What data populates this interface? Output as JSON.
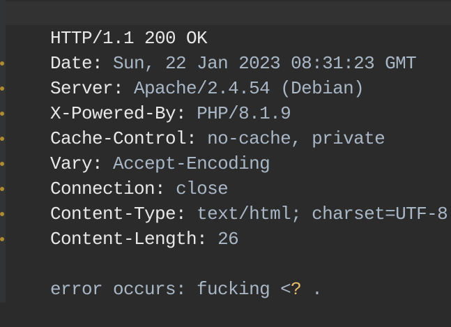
{
  "response": {
    "status_line": "HTTP/1.1 200 OK",
    "headers": [
      {
        "key": "Date",
        "sep": ": ",
        "value": "Sun, 22 Jan 2023 08:31:23 GMT"
      },
      {
        "key": "Server",
        "sep": ": ",
        "value": "Apache/2.4.54 (Debian)"
      },
      {
        "key": "X-Powered-By",
        "sep": ": ",
        "value": "PHP/8.1.9"
      },
      {
        "key": "Cache-Control",
        "sep": ": ",
        "value": "no-cache, private"
      },
      {
        "key": "Vary",
        "sep": ": ",
        "value": "Accept-Encoding"
      },
      {
        "key": "Connection",
        "sep": ": ",
        "value": "close"
      },
      {
        "key": "Content-Type",
        "sep": ": ",
        "value": "text/html; charset=UTF-8"
      },
      {
        "key": "Content-Length",
        "sep": ": ",
        "value": "26"
      }
    ],
    "body": {
      "text_before": "error occurs: fucking <",
      "highlight": "?",
      "text_after": " ."
    }
  },
  "colors": {
    "background": "#2b2b2b",
    "header_key": "#e8e8e8",
    "header_value": "#a9b7c6",
    "highlight": "#e8bf6a"
  }
}
